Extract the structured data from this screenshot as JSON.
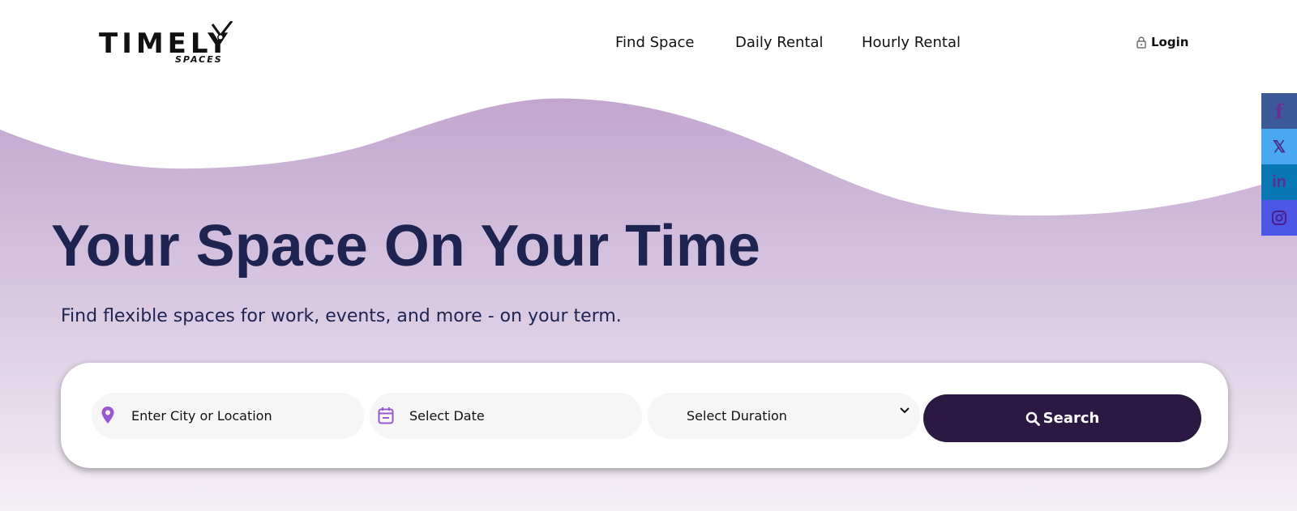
{
  "brand": {
    "name": "TIMELY",
    "tagline": "SPACES"
  },
  "nav": {
    "items": [
      {
        "label": "Find Space"
      },
      {
        "label": "Daily Rental"
      },
      {
        "label": "Hourly Rental"
      }
    ],
    "login_label": "Login",
    "login_icon": "lock-icon"
  },
  "social": {
    "items": [
      {
        "name": "facebook-icon",
        "glyph": "f"
      },
      {
        "name": "x-twitter-icon",
        "glyph": "𝕏"
      },
      {
        "name": "linkedin-icon",
        "glyph": "in"
      },
      {
        "name": "instagram-icon",
        "glyph": ""
      }
    ]
  },
  "hero": {
    "headline": "Your Space On Your Time",
    "subheadline": "Find flexible spaces for work, events, and more - on your term."
  },
  "search": {
    "location_placeholder": "Enter City or Location",
    "location_icon": "location-pin-icon",
    "date_placeholder": "Select Date",
    "date_icon": "calendar-icon",
    "duration_selected": "Select Duration",
    "duration_icon": "chevron-down-icon",
    "button_label": "Search",
    "button_icon": "search-icon"
  },
  "colors": {
    "hero_top": "#c6a9d1",
    "hero_bottom": "#f4eef6",
    "headline": "#1f2350",
    "button_bg": "#2b1843",
    "accent_icon": "#9b59d0"
  }
}
